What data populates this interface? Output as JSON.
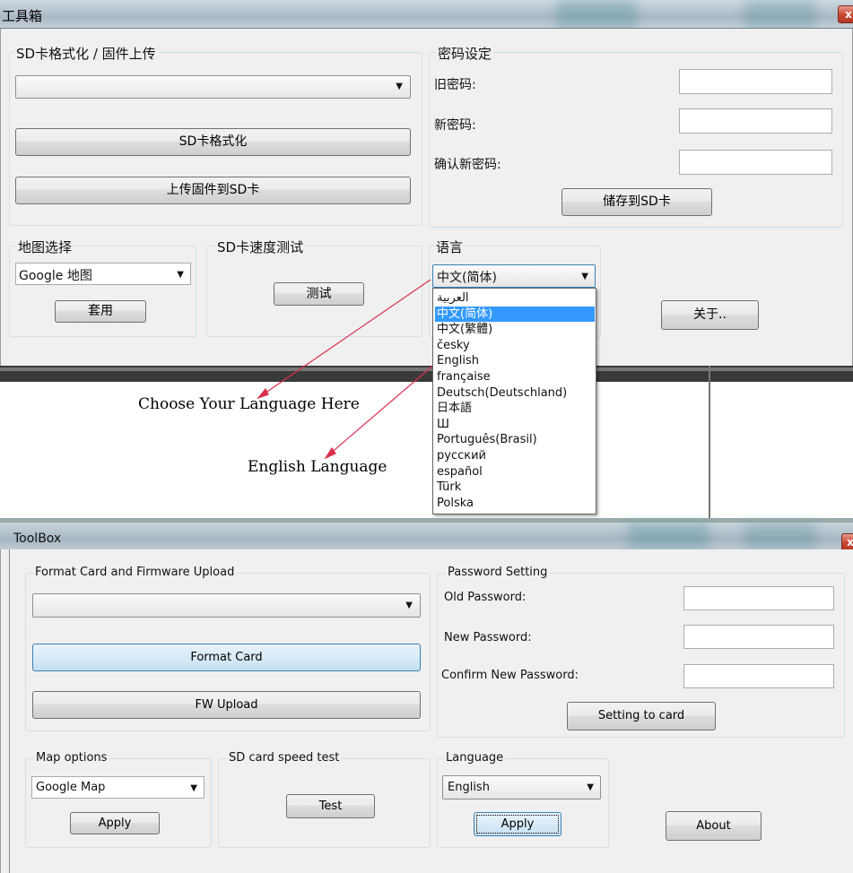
{
  "top_window": {
    "title": "工具箱",
    "close_glyph": "x",
    "sd_group": {
      "legend": "SD卡格式化 / 固件上传",
      "combo_value": "",
      "format_label": "SD卡格式化",
      "upload_label": "上传固件到SD卡"
    },
    "password_group": {
      "legend": "密码设定",
      "old_label": "旧密码:",
      "new_label": "新密码:",
      "confirm_label": "确认新密码:",
      "save_label": "储存到SD卡"
    },
    "map_group": {
      "legend": "地图选择",
      "value": "Google 地图",
      "apply_label": "套用"
    },
    "speed_group": {
      "legend": "SD卡速度测试",
      "test_label": "测试"
    },
    "language_group": {
      "legend": "语言",
      "value": "中文(简体)"
    },
    "about_label": "关于..",
    "language_options": [
      "العربية",
      "中文(简体)",
      "中文(繁體)",
      "česky",
      "English",
      "française",
      "Deutsch(Deutschland)",
      "日本語",
      "Ш",
      "Português(Brasil)",
      "русский",
      "español",
      "Türk",
      "Polska"
    ],
    "selected_option_index": 1
  },
  "annotations": {
    "choose_language": "Choose Your Language Here",
    "english_language": "English Language",
    "arrow_color": "#d9304a"
  },
  "bottom_window": {
    "title": "ToolBox",
    "close_glyph": "x",
    "format_group": {
      "legend": "Format Card and Firmware Upload",
      "combo_value": "",
      "format_label": "Format Card",
      "upload_label": "FW Upload"
    },
    "password_group": {
      "legend": "Password Setting",
      "old_label": "Old Password:",
      "new_label": "New Password:",
      "confirm_label": "Confirm New Password:",
      "save_label": "Setting to card"
    },
    "map_group": {
      "legend": "Map options",
      "value": "Google Map",
      "apply_label": "Apply"
    },
    "speed_group": {
      "legend": "SD card speed test",
      "test_label": "Test"
    },
    "language_group": {
      "legend": "Language",
      "value": "English",
      "apply_label": "Apply"
    },
    "about_label": "About"
  }
}
